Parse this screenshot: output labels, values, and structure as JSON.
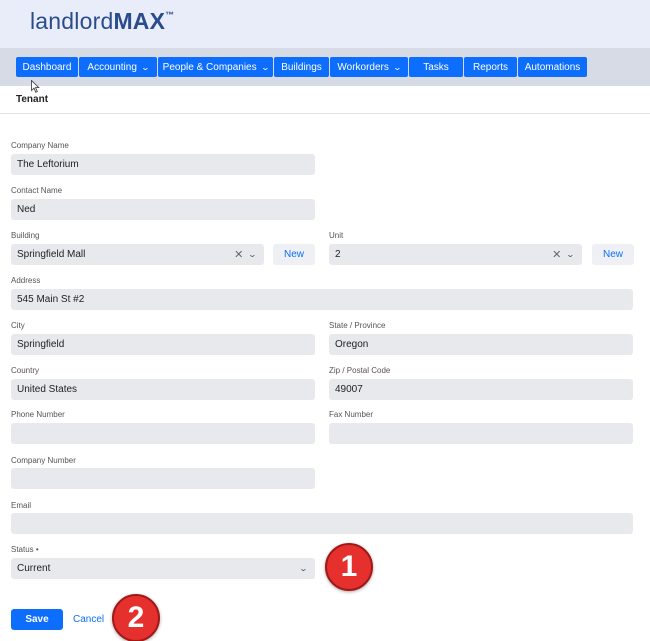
{
  "brand": {
    "light": "landlord",
    "bold": "MAX",
    "tm": "™"
  },
  "nav": {
    "items": [
      {
        "label": "Dashboard",
        "dropdown": false
      },
      {
        "label": "Accounting",
        "dropdown": true
      },
      {
        "label": "People & Companies",
        "dropdown": true
      },
      {
        "label": "Buildings",
        "dropdown": false
      },
      {
        "label": "Workorders",
        "dropdown": true
      },
      {
        "label": "Tasks",
        "dropdown": false
      },
      {
        "label": "Reports",
        "dropdown": false
      },
      {
        "label": "Automations",
        "dropdown": false
      }
    ]
  },
  "page": {
    "title": "Tenant"
  },
  "form": {
    "company_name": {
      "label": "Company Name",
      "value": "The Leftorium"
    },
    "contact_name": {
      "label": "Contact Name",
      "value": "Ned"
    },
    "building": {
      "label": "Building",
      "value": "Springfield Mall",
      "new_label": "New"
    },
    "unit": {
      "label": "Unit",
      "value": "2",
      "new_label": "New"
    },
    "address": {
      "label": "Address",
      "value": "545 Main St #2"
    },
    "city": {
      "label": "City",
      "value": "Springfield"
    },
    "state": {
      "label": "State / Province",
      "value": "Oregon"
    },
    "country": {
      "label": "Country",
      "value": "United States"
    },
    "zip": {
      "label": "Zip / Postal Code",
      "value": "49007"
    },
    "phone": {
      "label": "Phone Number",
      "value": ""
    },
    "fax": {
      "label": "Fax Number",
      "value": ""
    },
    "company_number": {
      "label": "Company Number",
      "value": ""
    },
    "email": {
      "label": "Email",
      "value": ""
    },
    "status": {
      "label": "Status •",
      "value": "Current"
    }
  },
  "actions": {
    "save_label": "Save",
    "cancel_label": "Cancel"
  },
  "annotations": {
    "badge1": "1",
    "badge2": "2"
  },
  "colors": {
    "primary": "#0d6efd",
    "header_bg": "#e9edfa",
    "nav_bg": "#d6dbe6",
    "field_bg": "#e8e9ed",
    "badge": "#e5302e"
  }
}
